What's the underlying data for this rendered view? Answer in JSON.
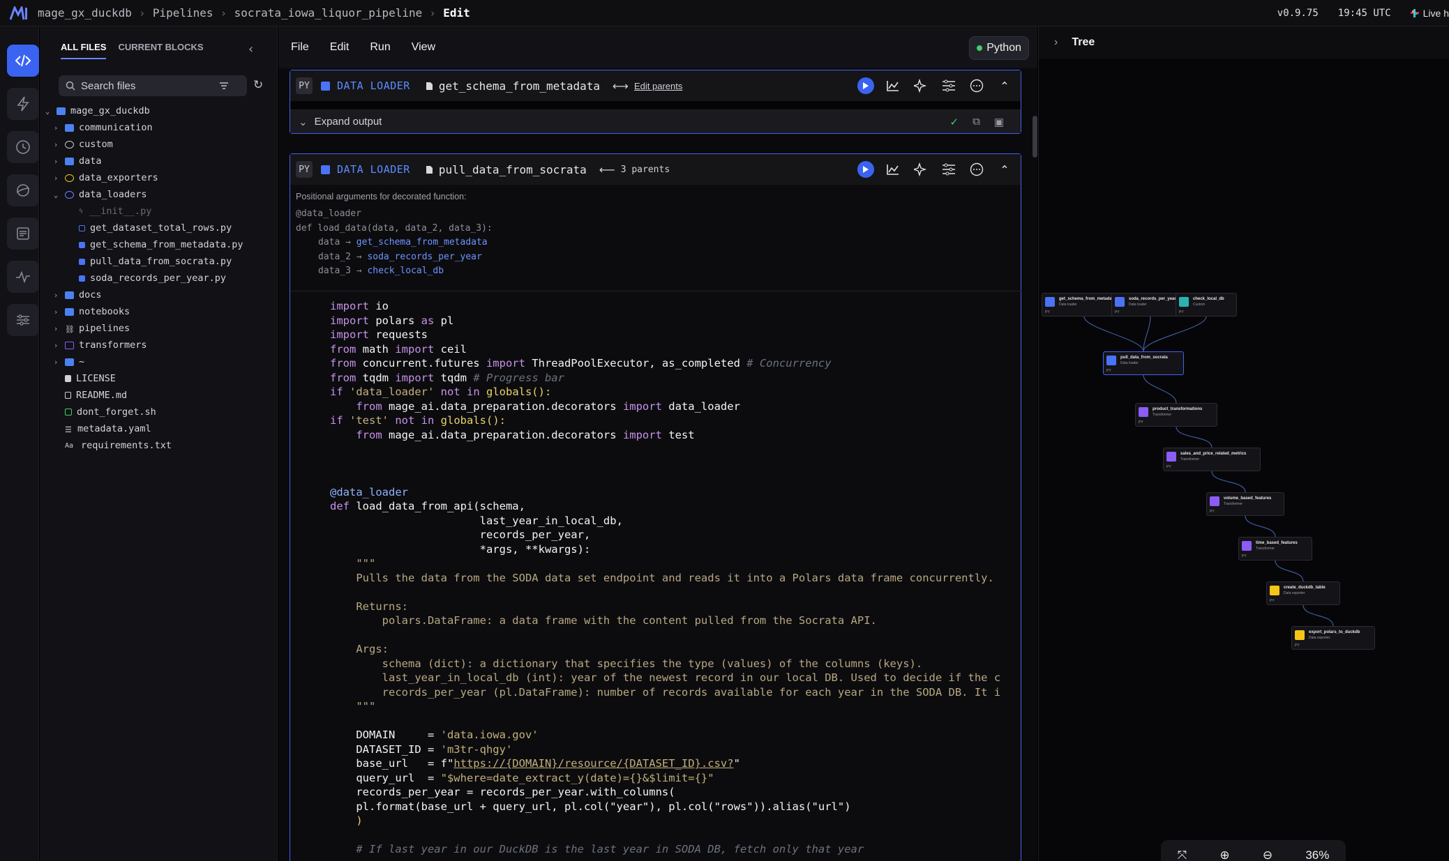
{
  "breadcrumbs": {
    "project": "mage_gx_duckdb",
    "section": "Pipelines",
    "pipeline": "socrata_iowa_liquor_pipeline",
    "mode": "Edit"
  },
  "topbar": {
    "version": "v0.9.75",
    "time": "19:45 UTC",
    "live": "Live h"
  },
  "file_browser": {
    "tab_all": "ALL FILES",
    "tab_current": "CURRENT BLOCKS",
    "search_placeholder": "Search files",
    "rows": [
      {
        "label": "mage_gx_duckdb"
      },
      {
        "label": "communication"
      },
      {
        "label": "custom"
      },
      {
        "label": "data"
      },
      {
        "label": "data_exporters"
      },
      {
        "label": "data_loaders"
      },
      {
        "label": "__init__.py"
      },
      {
        "label": "get_dataset_total_rows.py"
      },
      {
        "label": "get_schema_from_metadata.py"
      },
      {
        "label": "pull_data_from_socrata.py"
      },
      {
        "label": "soda_records_per_year.py"
      },
      {
        "label": "docs"
      },
      {
        "label": "notebooks"
      },
      {
        "label": "pipelines"
      },
      {
        "label": "transformers"
      },
      {
        "label": "~"
      },
      {
        "label": "LICENSE"
      },
      {
        "label": "README.md"
      },
      {
        "label": "dont_forget.sh"
      },
      {
        "label": "metadata.yaml"
      },
      {
        "label": "requirements.txt"
      }
    ]
  },
  "menu": {
    "file": "File",
    "edit": "Edit",
    "run": "Run",
    "view": "View",
    "kernel": "Python"
  },
  "block1": {
    "lang": "PY",
    "type": "DATA LOADER",
    "name": "get_schema_from_metadata",
    "parents_label": "Edit parents",
    "expand": "Expand output"
  },
  "block2": {
    "lang": "PY",
    "type": "DATA LOADER",
    "name": "pull_data_from_socrata",
    "parents_label": "3 parents",
    "positional_label": "Positional arguments for decorated function:",
    "sig_decorator": "@data_loader",
    "sig_def": "def load_data(data, data_2, data_3):",
    "args": [
      {
        "name": "data",
        "block": "get_schema_from_metadata"
      },
      {
        "name": "data_2",
        "block": "soda_records_per_year"
      },
      {
        "name": "data_3",
        "block": "check_local_db"
      }
    ]
  },
  "code": {
    "l1_kw": "import",
    "l1": " io",
    "l2_kw": "import",
    "l2a": " polars ",
    "l2_as": "as",
    "l2b": " pl",
    "l3_kw": "import",
    "l3": " requests",
    "l4_from": "from",
    "l4a": " math ",
    "l4_imp": "import",
    "l4b": " ceil",
    "l5_from": "from",
    "l5a": " concurrent.futures ",
    "l5_imp": "import",
    "l5b": " ThreadPoolExecutor, as_completed ",
    "l5_c": "# Concurrency",
    "l6_from": "from",
    "l6a": " tqdm ",
    "l6_imp": "import",
    "l6b": " tqdm ",
    "l6_c": "# Progress bar",
    "l7_if": "if",
    "l7_s": " 'data_loader'",
    "l7_not": " not in",
    "l7b": " globals():",
    "l8_from": "    from",
    "l8a": " mage_ai.data_preparation.decorators ",
    "l8_imp": "import",
    "l8b": " data_loader",
    "l9_if": "if",
    "l9_s": " 'test'",
    "l9_not": " not in",
    "l9b": " globals():",
    "l10_from": "    from",
    "l10a": " mage_ai.data_preparation.decorators ",
    "l10_imp": "import",
    "l10b": " test",
    "l11": "@data_loader",
    "l12_def": "def",
    "l12": " load_data_from_api(schema,",
    "l13": "                       last_year_in_local_db,",
    "l14": "                       records_per_year,",
    "l15": "                       *args, **kwargs):",
    "l16": "    \"\"\"",
    "l17": "    Pulls the data from the SODA data set endpoint and reads it into a Polars data frame concurrently.",
    "l18": "    Returns:",
    "l19": "        polars.DataFrame: a data frame with the content pulled from the Socrata API.",
    "l20": "    Args:",
    "l21": "        schema (dict): a dictionary that specifies the type (values) of the columns (keys).",
    "l22": "        last_year_in_local_db (int): year of the newest record in our local DB. Used to decide if the c",
    "l23": "        records_per_year (pl.DataFrame): number of records available for each year in the SODA DB. It i",
    "l24": "    \"\"\"",
    "l25a": "    DOMAIN     = ",
    "l25s": "'data.iowa.gov'",
    "l26a": "    DATASET_ID = ",
    "l26s": "'m3tr-qhgy'",
    "l27a": "    base_url   = f\"",
    "l27u": "https://{DOMAIN}/resource/{DATASET_ID}.csv?",
    "l27e": "\"",
    "l28a": "    query_url  = ",
    "l28s": "\"$where=date_extract_y(date)={}&$limit={}\"",
    "l29": "    records_per_year = records_per_year.with_columns(",
    "l30": "    pl.format(base_url + query_url, pl.col(\"year\"), pl.col(\"rows\")).alias(\"url\")",
    "l31": "    )",
    "l32": "    # If last year in our DuckDB is the last year in SODA DB, fetch only that year"
  },
  "tree_panel": {
    "title": "Tree",
    "zoom": "36%"
  },
  "dag_nodes": [
    {
      "name": "get_schema_from_metadata",
      "type": "Data loader",
      "lang": "PY",
      "color": "#4a73f5"
    },
    {
      "name": "soda_records_per_year",
      "type": "Data loader",
      "lang": "PY",
      "color": "#4a73f5"
    },
    {
      "name": "check_local_db",
      "type": "Custom",
      "lang": "PY",
      "color": "#2bb3b1"
    },
    {
      "name": "pull_data_from_socrata",
      "type": "Data loader",
      "lang": "PY",
      "color": "#4a73f5"
    },
    {
      "name": "product_transformations",
      "type": "Transformer",
      "lang": "PY",
      "color": "#8b5cf6"
    },
    {
      "name": "sales_and_price_related_metrics",
      "type": "Transformer",
      "lang": "PY",
      "color": "#8b5cf6"
    },
    {
      "name": "volume_based_features",
      "type": "Transformer",
      "lang": "PY",
      "color": "#8b5cf6"
    },
    {
      "name": "time_based_features",
      "type": "Transformer",
      "lang": "PY",
      "color": "#8b5cf6"
    },
    {
      "name": "create_duckdb_table",
      "type": "Data exporter",
      "lang": "PY",
      "color": "#f5c518"
    },
    {
      "name": "export_polars_to_duckdb",
      "type": "Data exporter",
      "lang": "PY",
      "color": "#f5c518"
    }
  ]
}
